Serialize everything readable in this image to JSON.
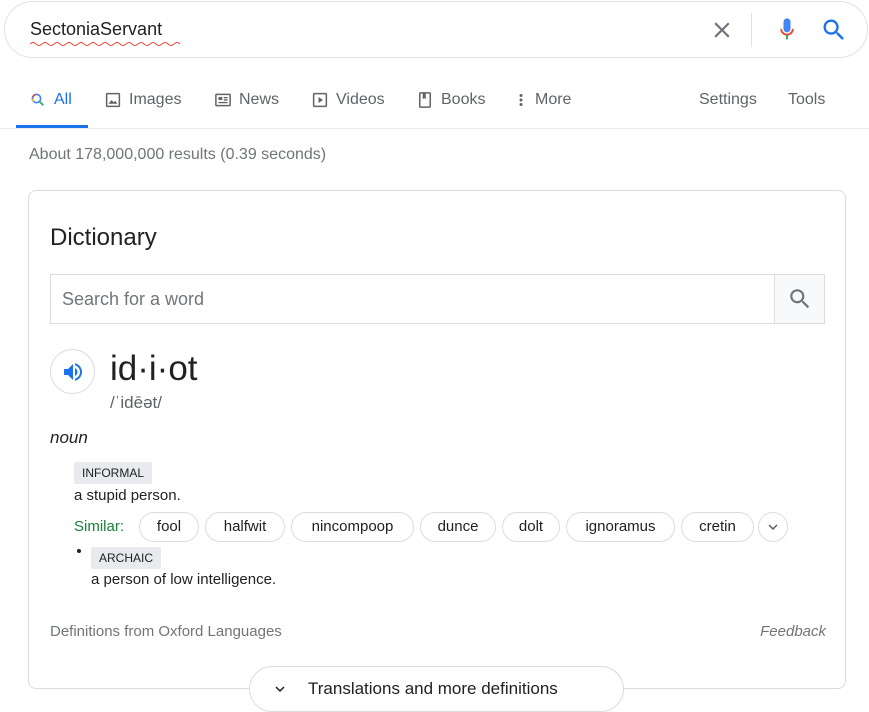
{
  "search": {
    "query": "SectoniaServant",
    "clear_icon": "close-icon",
    "mic_icon": "microphone-icon",
    "search_icon": "search-icon"
  },
  "tabs": [
    {
      "label": "All",
      "icon": "search-icon",
      "active": true
    },
    {
      "label": "Images",
      "icon": "image-icon"
    },
    {
      "label": "News",
      "icon": "newspaper-icon"
    },
    {
      "label": "Videos",
      "icon": "play-icon"
    },
    {
      "label": "Books",
      "icon": "book-icon"
    },
    {
      "label": "More",
      "icon": "vertical-dots-icon"
    },
    {
      "label": "Settings"
    },
    {
      "label": "Tools"
    }
  ],
  "result_stats": "About 178,000,000 results (0.39 seconds)",
  "dictionary": {
    "title": "Dictionary",
    "search_placeholder": "Search for a word",
    "headword": "id·i·ot",
    "phonetic": "/ˈidēət/",
    "part_of_speech": "noun",
    "senses": [
      {
        "label": "INFORMAL",
        "definition": "a stupid person."
      },
      {
        "label": "ARCHAIC",
        "definition": "a person of low intelligence."
      }
    ],
    "similar_label": "Similar:",
    "similar": [
      "fool",
      "halfwit",
      "nincompoop",
      "dunce",
      "dolt",
      "ignoramus",
      "cretin"
    ],
    "source": "Definitions from Oxford Languages",
    "feedback": "Feedback",
    "more_button": "Translations and more definitions"
  },
  "colors": {
    "accent_blue": "#1a73e8",
    "similar_green": "#188038",
    "spellcheck_red": "#ea4335"
  }
}
